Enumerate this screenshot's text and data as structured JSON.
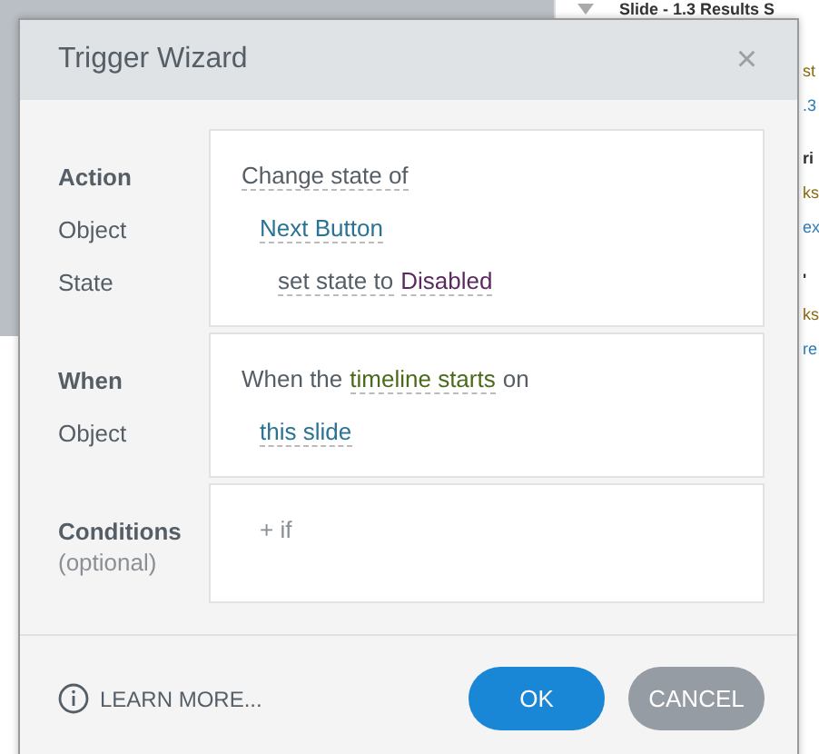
{
  "background": {
    "header": "Slide - 1.3 Results S",
    "fragments": [
      {
        "text": "st",
        "kind": "note"
      },
      {
        "text": ".3",
        "kind": "link"
      },
      {
        "text": "ri",
        "kind": "heading"
      },
      {
        "text": "ks",
        "kind": "note"
      },
      {
        "text": "ex",
        "kind": "link"
      },
      {
        "text": "'",
        "kind": "heading"
      },
      {
        "text": "ks",
        "kind": "note"
      },
      {
        "text": "re",
        "kind": "link"
      }
    ]
  },
  "dialog": {
    "title": "Trigger Wizard",
    "close": "×",
    "sections": [
      {
        "labels": [
          {
            "text": "Action",
            "kind": "heading"
          },
          {
            "text": "Object",
            "kind": "field"
          },
          {
            "text": "State",
            "kind": "field"
          }
        ],
        "lines": [
          {
            "kind": "action",
            "tokens": [
              {
                "text": "Change state of",
                "kind": "option"
              }
            ]
          },
          {
            "kind": "target",
            "tokens": [
              {
                "text": "Next Button",
                "kind": "object"
              }
            ]
          },
          {
            "kind": "state",
            "tokens": [
              {
                "text": "set state to",
                "kind": "option"
              },
              {
                "text": "Disabled",
                "kind": "value"
              }
            ]
          }
        ]
      },
      {
        "labels": [
          {
            "text": "When",
            "kind": "heading"
          },
          {
            "text": "Object",
            "kind": "field"
          }
        ],
        "lines": [
          {
            "kind": "action",
            "tokens": [
              {
                "text": "When the",
                "kind": "plain"
              },
              {
                "text": "timeline starts",
                "kind": "event"
              },
              {
                "text": "on",
                "kind": "plain"
              }
            ]
          },
          {
            "kind": "target",
            "tokens": [
              {
                "text": "this slide",
                "kind": "object"
              }
            ]
          }
        ]
      },
      {
        "labels": [
          {
            "text": "Conditions",
            "kind": "heading"
          },
          {
            "text": "(optional)",
            "kind": "hint"
          }
        ],
        "lines": [
          {
            "kind": "condition",
            "tokens": [
              {
                "text": "+ if",
                "kind": "add"
              }
            ]
          }
        ]
      }
    ],
    "footer": {
      "learn_more": "LEARN MORE...",
      "buttons": [
        {
          "label": "OK",
          "kind": "primary"
        },
        {
          "label": "CANCEL",
          "kind": "secondary"
        }
      ]
    }
  }
}
